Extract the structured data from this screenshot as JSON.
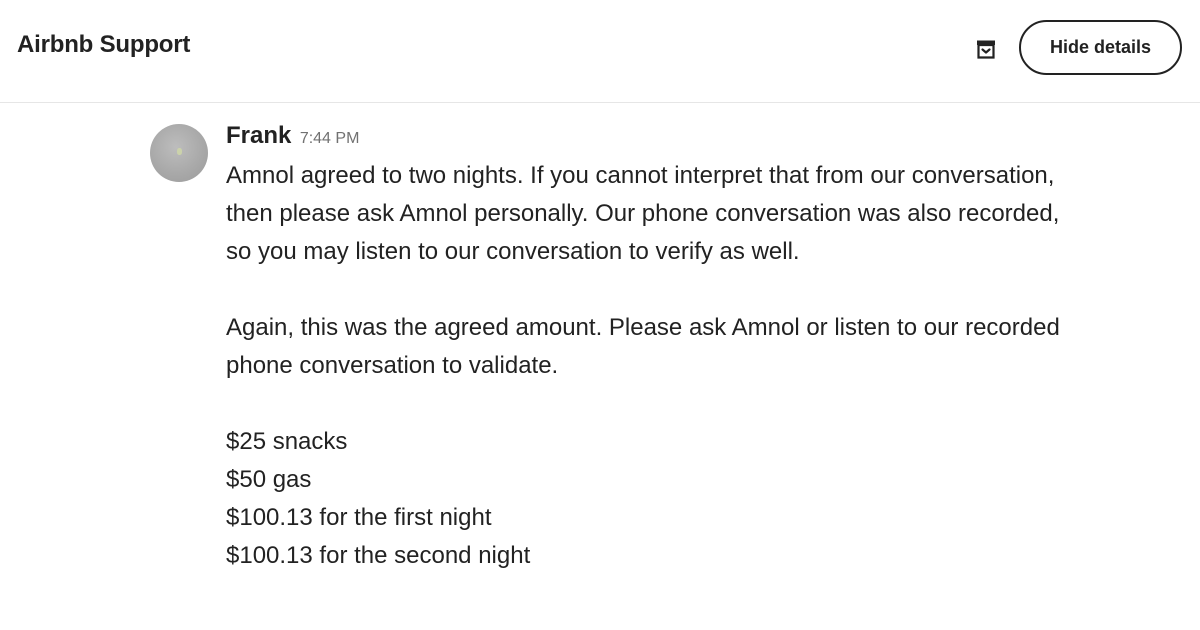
{
  "header": {
    "title": "Airbnb Support",
    "archive_icon": "archive-icon",
    "hide_details_label": "Hide details"
  },
  "message": {
    "sender": "Frank",
    "time": "7:44 PM",
    "paragraphs": [
      "Amnol agreed to two nights. If you cannot interpret that from our conversation, then please ask Amnol personally. Our phone conversation was also recorded, so you may listen to our conversation to verify as well.",
      "Again, this was the agreed amount. Please ask Amnol or listen to our recorded phone conversation to validate."
    ],
    "items": [
      "$25 snacks",
      "$50 gas",
      "$100.13 for the first night",
      "$100.13 for the second night"
    ]
  }
}
